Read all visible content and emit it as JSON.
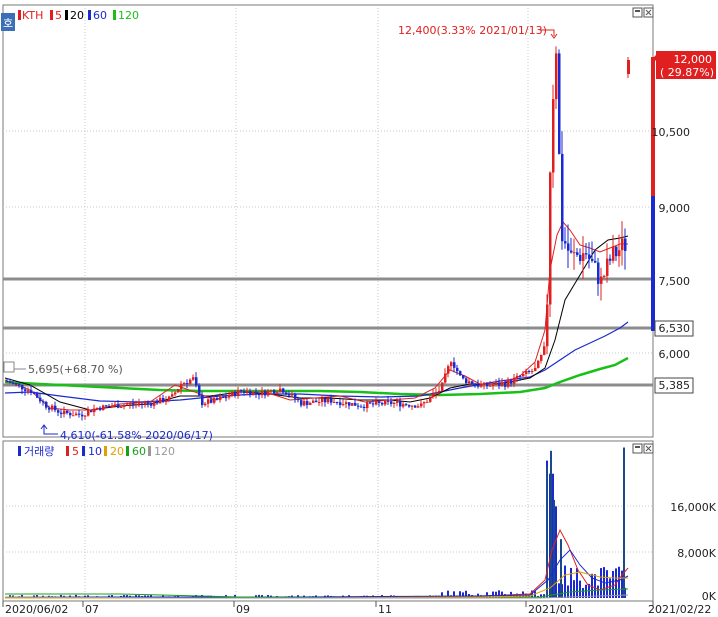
{
  "chart_data": [
    {
      "type": "candlestick",
      "symbol": "KTH",
      "legend": [
        {
          "name": "KTH",
          "color": "#e02020"
        },
        {
          "name": "5",
          "color": "#e02020"
        },
        {
          "name": "20",
          "color": "#000000"
        },
        {
          "name": "60",
          "color": "#1a2ad0"
        },
        {
          "name": "120",
          "color": "#19c019"
        }
      ],
      "y_ticks": [
        "10,500",
        "9,000",
        "7,500",
        "6,000"
      ],
      "ylim": [
        4300,
        13200
      ],
      "current_price": "12,000",
      "current_change": "( 29.87%)",
      "max_annotation": "12,400(3.33% 2021/01/13)",
      "min_annotation": "4,610(-61.58% 2020/06/17)",
      "start_annotation": "5,695(+68.70 %)",
      "hlines": [
        {
          "value": 7530,
          "label": ""
        },
        {
          "value": 6530,
          "label": "6,530"
        },
        {
          "value": 5385,
          "label": "5,385"
        }
      ],
      "series_summary": {
        "pre_rally_range": [
          4900,
          5700
        ],
        "rally_peak": 12400,
        "last_close": 12000
      }
    },
    {
      "type": "bar",
      "title": "거래량",
      "legend": [
        {
          "name": "거래량",
          "color": "#1a2ad0"
        },
        {
          "name": "5",
          "color": "#e02020"
        },
        {
          "name": "10",
          "color": "#1a2ad0"
        },
        {
          "name": "20",
          "color": "#e0a000"
        },
        {
          "name": "60",
          "color": "#19a019"
        },
        {
          "name": "120",
          "color": "#999999"
        }
      ],
      "y_ticks": [
        "16,000K",
        "8,000K",
        "0K"
      ],
      "ylim": [
        0,
        24000
      ]
    }
  ],
  "x_labels": [
    "2020/06/02",
    "07",
    "09",
    "11",
    "2021/01",
    "2021/02/22"
  ],
  "panel_icon_label": "호"
}
